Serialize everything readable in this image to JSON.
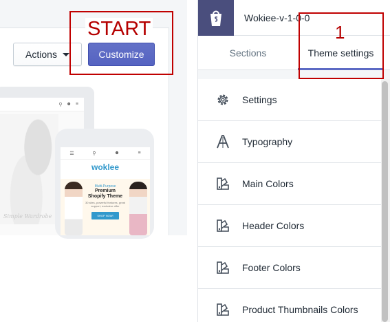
{
  "admin": {
    "actions_label": "Actions",
    "customize_label": "Customize",
    "annotation_start": "START"
  },
  "preview": {
    "brand": "woklee",
    "tag": "Multi-Purpose",
    "headline_1": "Premium",
    "headline_2": "Shopify Theme",
    "subtext_1": "30 sites, powerful features, great",
    "subtext_2": "support, exclusive offer",
    "shop_button": "SHOP NOW!",
    "laptop_script": "Simple Wardrobe"
  },
  "editor": {
    "theme_name": "Wokiee-v-1-0-0",
    "tabs": [
      {
        "label": "Sections",
        "active": false
      },
      {
        "label": "Theme settings",
        "active": true
      }
    ],
    "annotation_step": "1",
    "settings_items": [
      {
        "label": "Settings",
        "icon": "gear-icon"
      },
      {
        "label": "Typography",
        "icon": "typography-icon"
      },
      {
        "label": "Main Colors",
        "icon": "color-palette-icon"
      },
      {
        "label": "Header Colors",
        "icon": "color-palette-icon"
      },
      {
        "label": "Footer Colors",
        "icon": "color-palette-icon"
      },
      {
        "label": "Product Thumbnails Colors",
        "icon": "color-palette-icon"
      }
    ]
  },
  "colors": {
    "primary": "#5c6ac4",
    "annotation": "#c00000",
    "shop_logo_bg": "#4a4e7d",
    "brand_blue": "#3399cc"
  }
}
